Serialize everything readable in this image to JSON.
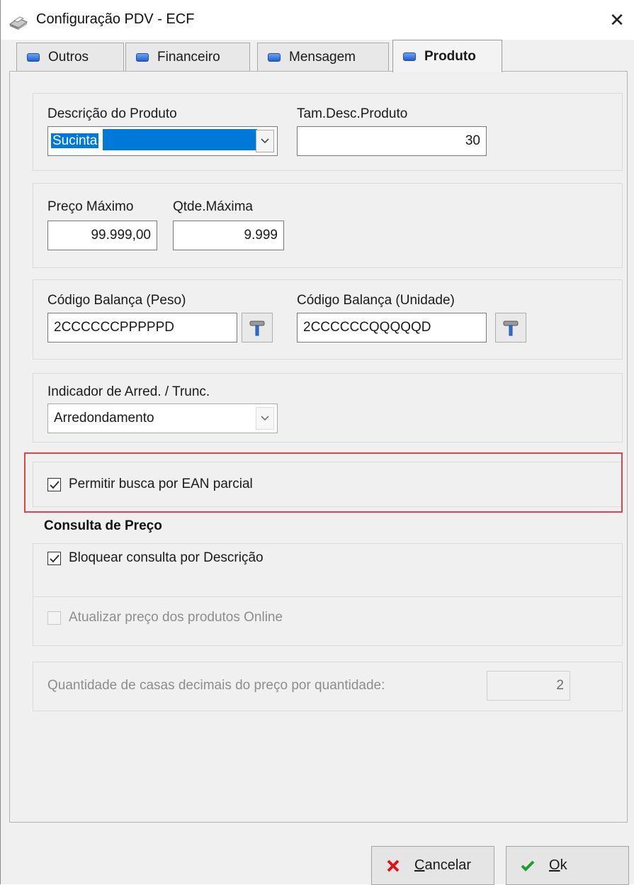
{
  "window": {
    "title": "Configuração PDV - ECF",
    "close_glyph": "✕"
  },
  "tabs": [
    {
      "label": "Outros",
      "active": false
    },
    {
      "label": "Financeiro",
      "active": false
    },
    {
      "label": "Mensagem",
      "active": false
    },
    {
      "label": "Produto",
      "active": true
    }
  ],
  "produto": {
    "descricao_label": "Descrição do Produto",
    "descricao_value": "Sucinta",
    "tam_desc_label": "Tam.Desc.Produto",
    "tam_desc_value": "30",
    "preco_max_label": "Preço Máximo",
    "preco_max_value": "99.999,00",
    "qtde_max_label": "Qtde.Máxima",
    "qtde_max_value": "9.999",
    "balanca_peso_label": "Código Balança (Peso)",
    "balanca_peso_value": "2CCCCCCPPPPPD",
    "balanca_unidade_label": "Código Balança (Unidade)",
    "balanca_unidade_value": "2CCCCCCQQQQQD",
    "indicador_label": "Indicador de Arred. / Trunc.",
    "indicador_value": "Arredondamento",
    "ean_parcial_label": "Permitir busca por EAN parcial",
    "ean_parcial_checked": true,
    "consulta_preco_title": "Consulta de Preço",
    "bloquear_label": "Bloquear consulta por Descrição",
    "bloquear_checked": true,
    "online_label": "Atualizar preço dos produtos Online",
    "online_checked": false,
    "casas_decimais_label": "Quantidade de casas decimais do preço por quantidade:",
    "casas_decimais_value": "2"
  },
  "footer": {
    "cancel_label": "Cancelar",
    "ok_label": "Ok"
  },
  "colors": {
    "selection": "#0078d7",
    "highlight_border": "#e3434b",
    "cancel_icon": "#d9141b",
    "ok_icon": "#1a9e2e"
  }
}
